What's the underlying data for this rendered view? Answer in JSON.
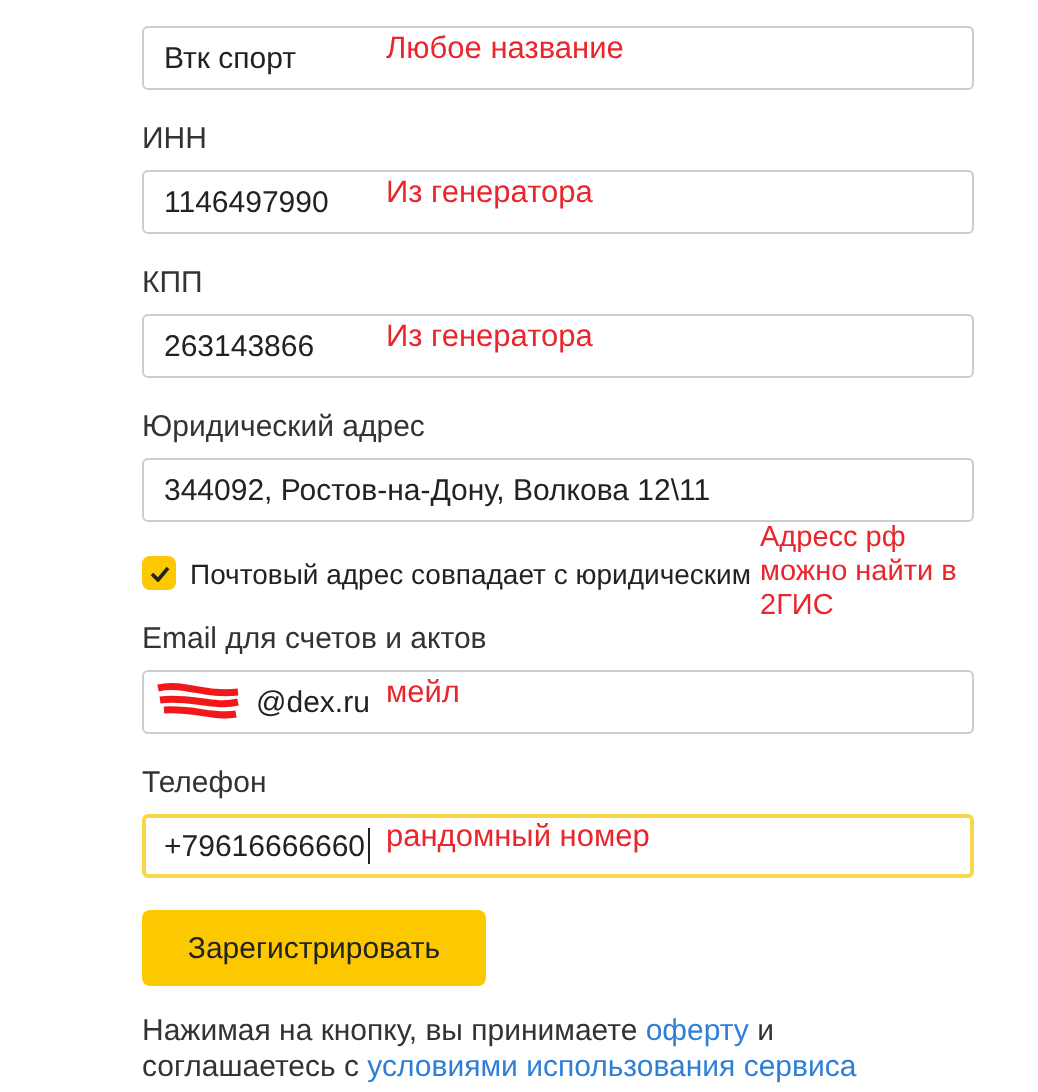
{
  "fields": [
    {
      "value": "Втк спорт",
      "focused": false,
      "annotation": "Любое название"
    },
    {
      "label": "ИНН",
      "value": "1146497990",
      "focused": false,
      "annotation": "Из генератора"
    },
    {
      "label": "КПП",
      "value": "263143866",
      "focused": false,
      "annotation": "Из генератора"
    },
    {
      "label": "Юридический адрес",
      "value": "344092, Ростов-на-Дону, Волкова 12\\11",
      "focused": false,
      "annotation": "Адресс рф можно найти в 2ГИС"
    },
    {
      "kind": "checkbox",
      "label": "Почтовый адрес совпадает с юридическим",
      "checked": true
    },
    {
      "label": "Email для счетов и актов",
      "value": "@dex.ru",
      "redacted": true,
      "focused": false,
      "annotation": "мейл"
    },
    {
      "label": "Телефон",
      "value": "+79616666660",
      "focused": true,
      "annotation": "рандомный номер"
    }
  ],
  "submit": "Зарегистрировать",
  "terms": {
    "before": "Нажимая на кнопку, вы принимаете ",
    "link1": "оферту",
    "middle": " и соглашаетесь с ",
    "link2": "условиями использования сервиса"
  }
}
